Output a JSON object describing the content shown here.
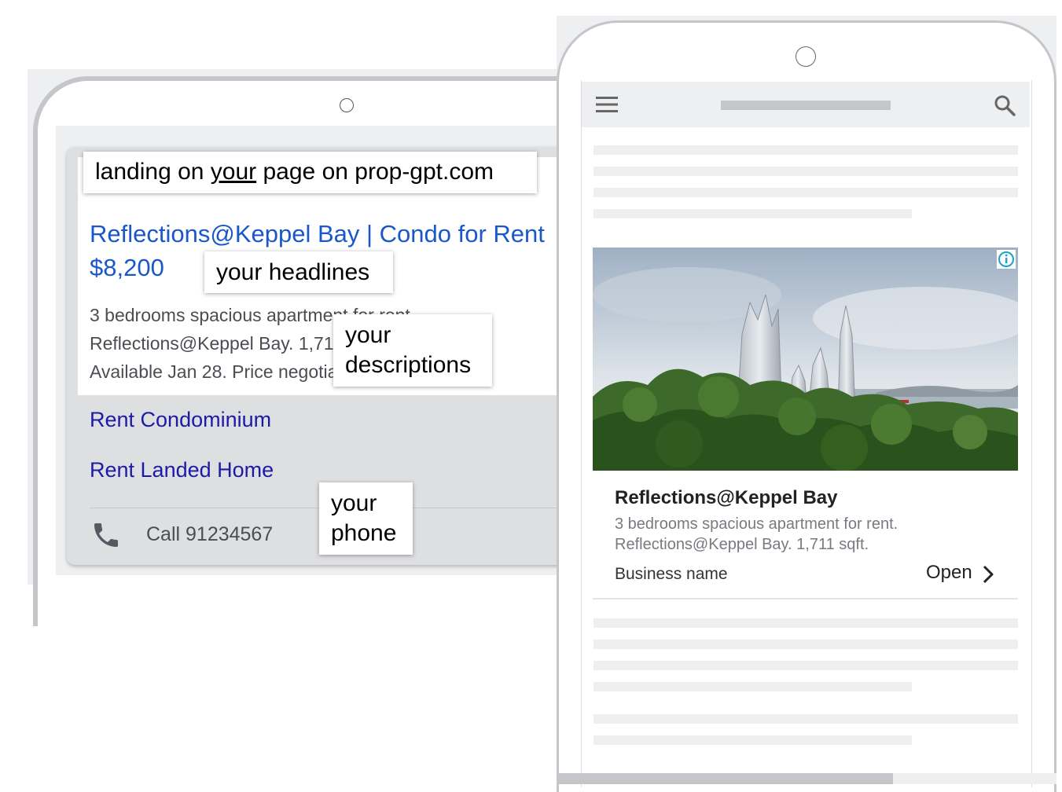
{
  "left_ad": {
    "headline_line1": "Reflections@Keppel Bay | Condo for Rent",
    "headline_line2": "$8,200",
    "description_line1": "3 bedrooms spacious apartment for rent.",
    "description_line2": "Reflections@Keppel Bay. 1,711 sqft. Sea view.",
    "description_line3": "Available Jan 28. Price negotiable.",
    "sitelinks": [
      {
        "label": "Rent Condominium"
      },
      {
        "label": "Rent Landed Home"
      }
    ],
    "call_label": "Call 91234567",
    "call_icon": "phone-icon"
  },
  "callouts": {
    "landing_prefix": "landing on ",
    "landing_underlined": "your",
    "landing_suffix": " page on prop-gpt.com",
    "headlines": "your headlines",
    "descriptions_line1": "your",
    "descriptions_line2": "descriptions",
    "phone_line1": "your",
    "phone_line2": "phone"
  },
  "right_ad": {
    "title": "Reflections@Keppel Bay",
    "description_line1": "3 bedrooms spacious apartment for rent.",
    "description_line2": "Reflections@Keppel Bay. 1,711 sqft.",
    "business_name": "Business name",
    "open_label": "Open",
    "icons": [
      "menu-icon",
      "search-icon",
      "info-icon",
      "chevron-right-icon"
    ]
  },
  "colors": {
    "headline_blue": "#1a57c9",
    "sitelink_blue": "#1c1aa8",
    "frame_gray": "#c4c6ca",
    "screen_gray": "#eeeff1"
  }
}
